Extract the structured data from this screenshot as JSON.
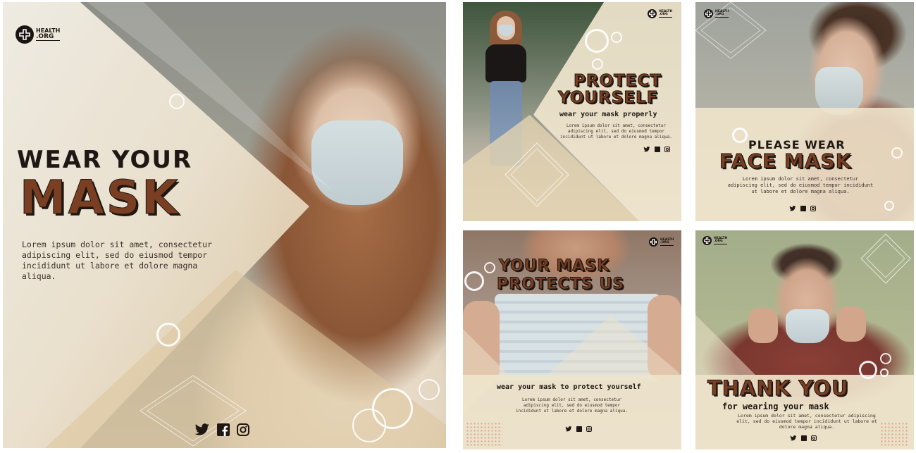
{
  "brand": {
    "line1": "HEALTH",
    "line2": ".ORG"
  },
  "lorem": "Lorem ipsum dolor sit amet, consectetur adipiscing elit, sed do eiusmod tempor incididunt ut labore et dolore magna aliqua.",
  "lorem_small": "Lorem ipsum dolor sit amet, consectetur adipiscing elit, sed do eiusmod tempor incididunt ut labore et dolore magna aliqua.",
  "social_icons": [
    "twitter-icon",
    "facebook-icon",
    "instagram-icon"
  ],
  "posts": {
    "main": {
      "line1": "WEAR YOUR",
      "line2": "MASK"
    },
    "protect": {
      "line1": "PROTECT",
      "line2": "YOURSELF",
      "sub": "wear your mask properly"
    },
    "face": {
      "line1": "PLEASE WEAR",
      "line2": "FACE MASK"
    },
    "protects_us": {
      "line1": "YOUR MASK",
      "line2": "PROTECTS US",
      "sub": "wear your mask to protect yourself"
    },
    "thanks": {
      "line1": "THANK YOU",
      "sub": "for wearing your mask"
    }
  },
  "colors": {
    "beige": "#e8d8ba",
    "brown": "#7a3f22",
    "dark": "#1e1713",
    "olive": "#a7ae8a"
  }
}
